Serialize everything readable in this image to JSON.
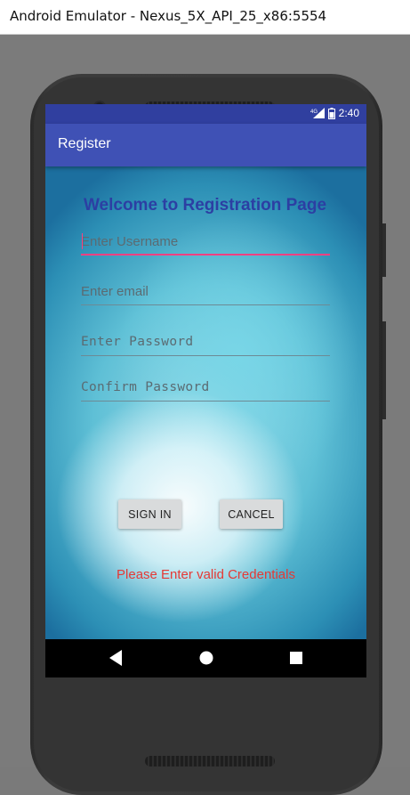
{
  "window": {
    "title": "Android Emulator - Nexus_5X_API_25_x86:5554"
  },
  "statusbar": {
    "network": "4G",
    "time": "2:40"
  },
  "appbar": {
    "title": "Register"
  },
  "form": {
    "heading": "Welcome to Registration Page",
    "username": {
      "placeholder": "Enter Username",
      "value": ""
    },
    "email": {
      "placeholder": "Enter email",
      "value": ""
    },
    "password": {
      "placeholder": "Enter Password",
      "value": ""
    },
    "confirm_password": {
      "placeholder": "Confirm Password",
      "value": ""
    },
    "sign_in_label": "SIGN IN",
    "cancel_label": "CANCEL",
    "error_message": "Please Enter valid Credentials"
  },
  "fab": {
    "icon": "email-icon"
  },
  "navbar": {
    "icons": [
      "back-icon",
      "home-icon",
      "recents-icon"
    ]
  },
  "colors": {
    "primary": "#3f51b5",
    "primary_dark": "#303f9f",
    "accent": "#ff4081",
    "heading": "#2c3fa3",
    "error": "#e53935"
  }
}
